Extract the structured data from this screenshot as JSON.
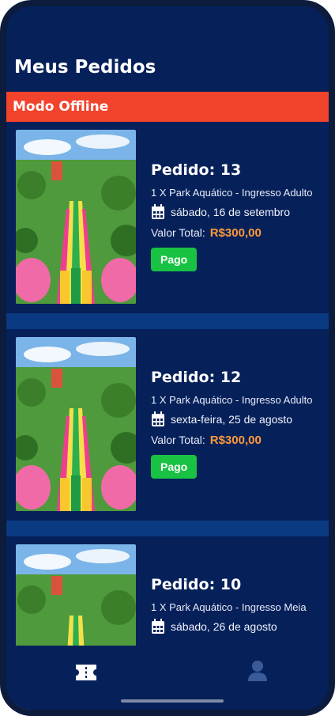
{
  "header": {
    "title": "Meus Pedidos"
  },
  "banner": {
    "text": "Modo Offline"
  },
  "labels": {
    "total": "Valor Total:"
  },
  "colors": {
    "background": "#06205a",
    "banner": "#f2432c",
    "paid": "#19c243",
    "price": "#ff9a3a",
    "separator": "#0a3a82"
  },
  "orders": [
    {
      "title": "Pedido: 13",
      "product": "1 X Park Aquático - Ingresso Adulto",
      "date": "sábado, 16 de setembro",
      "total": "R$300,00",
      "status": "Pago"
    },
    {
      "title": "Pedido: 12",
      "product": "1 X Park Aquático - Ingresso Adulto",
      "date": "sexta-feira, 25 de agosto",
      "total": "R$300,00",
      "status": "Pago"
    },
    {
      "title": "Pedido: 10",
      "product": "1 X Park Aquático - Ingresso Meia",
      "date": "sábado, 26 de agosto",
      "total": "",
      "status": ""
    }
  ],
  "nav": {
    "tickets_icon": "ticket-icon",
    "profile_icon": "user-icon"
  }
}
